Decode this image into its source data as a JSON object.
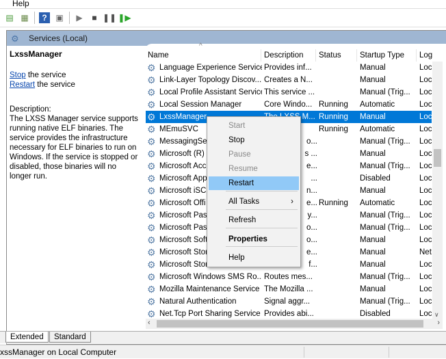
{
  "menubar": {
    "help": "Help"
  },
  "toolbar": {
    "icons": [
      "export-icon",
      "properties-icon",
      "help-icon",
      "console-icon",
      "play-icon",
      "stop-icon",
      "pause-icon",
      "resume-icon"
    ]
  },
  "header": {
    "title": "Services (Local)"
  },
  "left": {
    "service_name": "LxssManager",
    "stop_link": "Stop",
    "stop_rest": " the service",
    "restart_link": "Restart",
    "restart_rest": " the service",
    "description_label": "Description:",
    "description": "The LXSS Manager service supports running native ELF binaries. The service provides the infrastructure necessary for ELF binaries to run on Windows. If the service is stopped or disabled, those binaries will no longer run."
  },
  "columns": [
    "Name",
    "Description",
    "Status",
    "Startup Type",
    "Log"
  ],
  "rows": [
    {
      "name": "Language Experience Service",
      "desc": "Provides inf...",
      "status": "",
      "startup": "Manual",
      "log": "Loc"
    },
    {
      "name": "Link-Layer Topology Discov...",
      "desc": "Creates a N...",
      "status": "",
      "startup": "Manual",
      "log": "Loc"
    },
    {
      "name": "Local Profile Assistant Service",
      "desc": "This service ...",
      "status": "",
      "startup": "Manual (Trig...",
      "log": "Loc"
    },
    {
      "name": "Local Session Manager",
      "desc": "Core Windo...",
      "status": "Running",
      "startup": "Automatic",
      "log": "Loc"
    },
    {
      "name": "LxssManager",
      "desc": "The LXSS M...",
      "status": "Running",
      "startup": "Manual",
      "log": "Loc"
    },
    {
      "name": "MEmuSVC",
      "desc": "",
      "status": "Running",
      "startup": "Automatic",
      "log": "Loc"
    },
    {
      "name": "MessagingSer",
      "desc": "o...",
      "status": "",
      "startup": "Manual (Trig...",
      "log": "Loc"
    },
    {
      "name": "Microsoft (R)",
      "desc": "s ...",
      "status": "",
      "startup": "Manual",
      "log": "Loc"
    },
    {
      "name": "Microsoft Acc",
      "desc": "e...",
      "status": "",
      "startup": "Manual (Trig...",
      "log": "Loc"
    },
    {
      "name": "Microsoft App",
      "desc": "...",
      "status": "",
      "startup": "Disabled",
      "log": "Loc"
    },
    {
      "name": "Microsoft iSCS",
      "desc": "n...",
      "status": "",
      "startup": "Manual",
      "log": "Loc"
    },
    {
      "name": "Microsoft Offi",
      "desc": "e...",
      "status": "Running",
      "startup": "Automatic",
      "log": "Loc"
    },
    {
      "name": "Microsoft Pas",
      "desc": "y...",
      "status": "",
      "startup": "Manual (Trig...",
      "log": "Loc"
    },
    {
      "name": "Microsoft Pas",
      "desc": "o...",
      "status": "",
      "startup": "Manual (Trig...",
      "log": "Loc"
    },
    {
      "name": "Microsoft Soft",
      "desc": "o...",
      "status": "",
      "startup": "Manual",
      "log": "Loc"
    },
    {
      "name": "Microsoft Stor",
      "desc": "e...",
      "status": "",
      "startup": "Manual",
      "log": "Net"
    },
    {
      "name": "Microsoft Stor",
      "desc": "f...",
      "status": "",
      "startup": "Manual",
      "log": "Loc"
    },
    {
      "name": "Microsoft Windows SMS Ro...",
      "desc": "Routes mes...",
      "status": "",
      "startup": "Manual (Trig...",
      "log": "Loc"
    },
    {
      "name": "Mozilla Maintenance Service",
      "desc": "The Mozilla ...",
      "status": "",
      "startup": "Manual",
      "log": "Loc"
    },
    {
      "name": "Natural Authentication",
      "desc": "Signal aggr...",
      "status": "",
      "startup": "Manual (Trig...",
      "log": "Loc"
    },
    {
      "name": "Net.Tcp Port Sharing Service",
      "desc": "Provides abi...",
      "status": "",
      "startup": "Disabled",
      "log": "Loc"
    }
  ],
  "selected_row": 4,
  "context_menu": [
    {
      "label": "Start",
      "state": "disabled"
    },
    {
      "label": "Stop",
      "state": "enabled"
    },
    {
      "label": "Pause",
      "state": "disabled"
    },
    {
      "label": "Resume",
      "state": "disabled"
    },
    {
      "label": "Restart",
      "state": "highlighted"
    },
    {
      "label": "All Tasks",
      "state": "submenu"
    },
    {
      "label": "Refresh",
      "state": "enabled"
    },
    {
      "label": "Properties",
      "state": "bold"
    },
    {
      "label": "Help",
      "state": "enabled"
    }
  ],
  "tabs": [
    "Extended",
    "Standard"
  ],
  "statusbar": "xssManager on Local Computer",
  "colors": {
    "header": "#9fb6d2",
    "selection": "#0078d7",
    "menu_highlight": "#91c9f7"
  }
}
